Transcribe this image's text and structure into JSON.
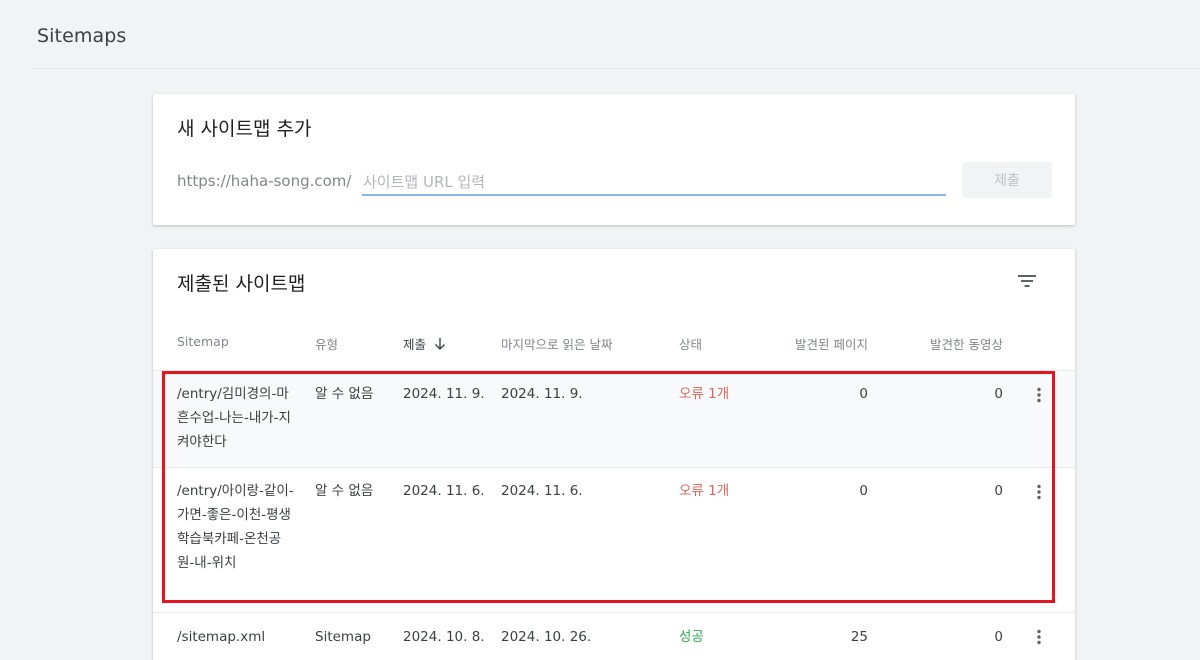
{
  "page": {
    "title": "Sitemaps"
  },
  "add_sitemap": {
    "title": "새 사이트맵 추가",
    "url_prefix": "https://haha-song.com/",
    "input_value": "",
    "input_placeholder": "사이트맵 URL 입력",
    "submit_label": "제출"
  },
  "submitted_sitemaps": {
    "title": "제출된 사이트맵",
    "filter_icon": "filter-icon",
    "columns": {
      "sitemap": "Sitemap",
      "type": "유형",
      "submitted": "제출",
      "last_read": "마지막으로 읽은 날짜",
      "status": "상태",
      "pages": "발견된 페이지",
      "videos": "발견한 동영상"
    },
    "sort": {
      "column": "submitted",
      "direction": "descending",
      "icon": "arrow-down-icon"
    },
    "rows": [
      {
        "sitemap": "/entry/김미경의-마흔수업-나는-내가-지켜야한다",
        "type": "알 수 없음",
        "submitted": "2024. 11. 9.",
        "last_read": "2024. 11. 9.",
        "status": "오류 1개",
        "pages": "0",
        "videos": "0"
      },
      {
        "sitemap": "/entry/아이랑-같이-가면-좋은-이천-평생학습북카페-온천공원-내-위치",
        "type": "알 수 없음",
        "submitted": "2024. 11. 6.",
        "last_read": "2024. 11. 6.",
        "status": "오류 1개",
        "pages": "0",
        "videos": "0"
      },
      {
        "sitemap": "/sitemap.xml",
        "type": "Sitemap",
        "submitted": "2024. 10. 8.",
        "last_read": "2024. 10. 26.",
        "status": "성공",
        "pages": "25",
        "videos": "0"
      }
    ]
  },
  "colors": {
    "error": "#d9665b",
    "success": "#34a853",
    "highlight_box": "#e2141d",
    "input_underline": "#8ab4f8"
  }
}
